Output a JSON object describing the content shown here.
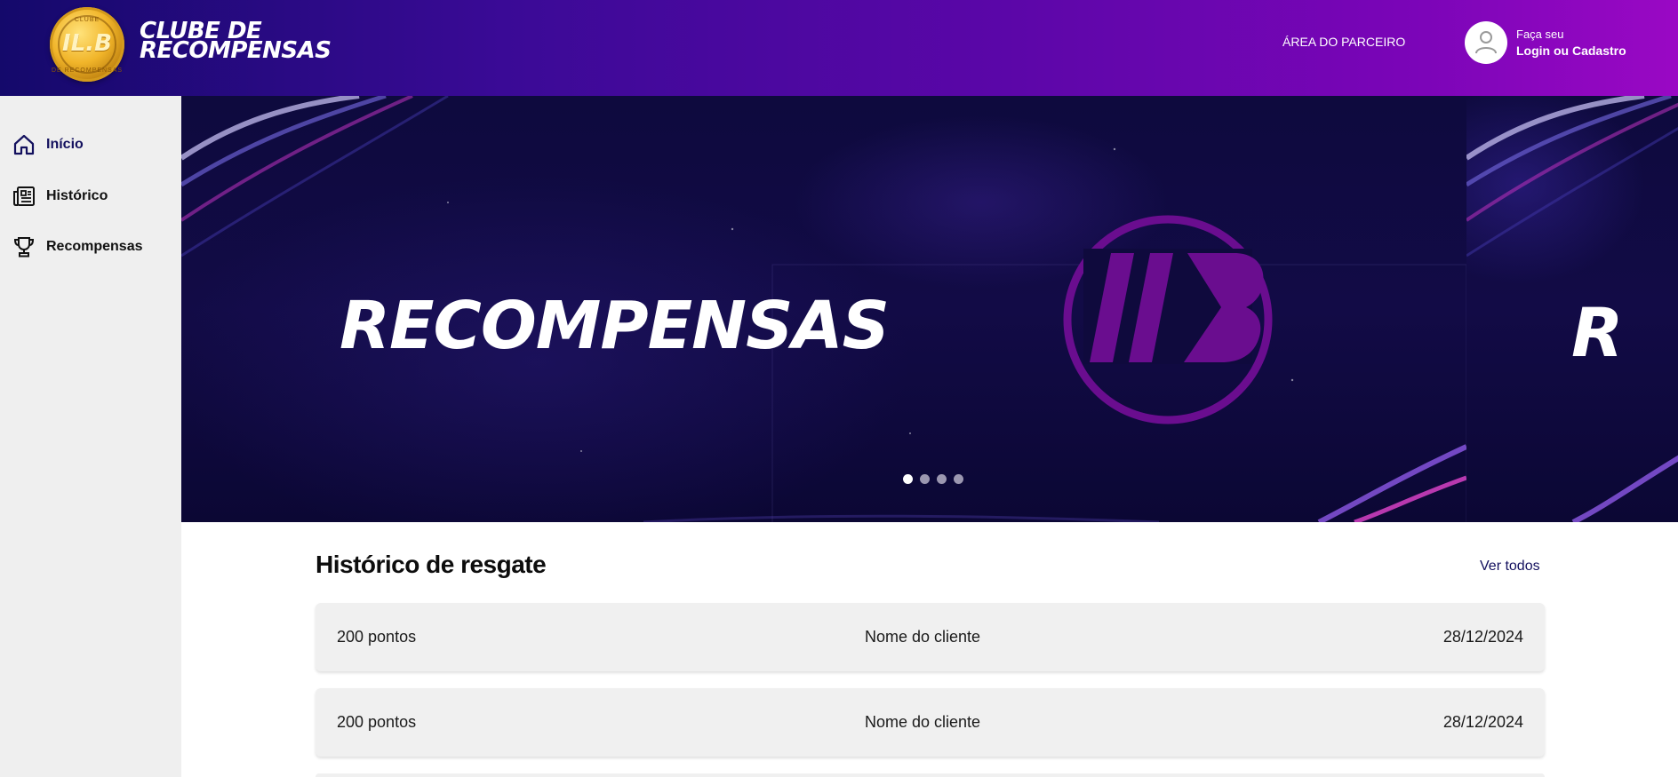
{
  "header": {
    "brand_line1": "CLUBE DE",
    "brand_line2": "RECOMPENSAS",
    "logo_monogram": "IL.B",
    "logo_ring_top": "CLUBE",
    "logo_ring_bottom": "DE RECOMPENSAS",
    "partner_link": "ÁREA DO PARCEIRO",
    "login_line1": "Faça seu",
    "login_line2": "Login ou Cadastro",
    "gradient_start": "#14096b",
    "gradient_end": "#9a08c4"
  },
  "sidebar": {
    "items": [
      {
        "label": "Início",
        "icon": "home-icon",
        "active": true
      },
      {
        "label": "Histórico",
        "icon": "newspaper-icon",
        "active": false
      },
      {
        "label": "Recompensas",
        "icon": "trophy-icon",
        "active": false
      }
    ],
    "active_color": "#13105e"
  },
  "banner": {
    "title": "RECOMPENSAS",
    "next_slide_peek": "R",
    "slides_count": 4,
    "active_slide": 1,
    "emblem_color": "#6a0d8f"
  },
  "history": {
    "title": "Histórico de resgate",
    "see_all": "Ver todos",
    "rows": [
      {
        "points": "200 pontos",
        "client": "Nome do cliente",
        "date": "28/12/2024"
      },
      {
        "points": "200 pontos",
        "client": "Nome do cliente",
        "date": "28/12/2024"
      }
    ]
  }
}
